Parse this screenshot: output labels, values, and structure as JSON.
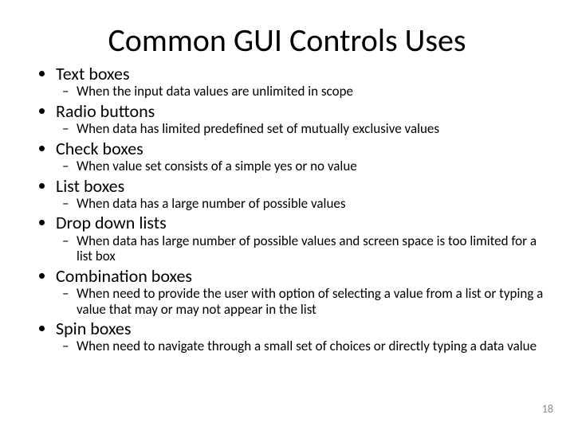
{
  "title": "Common GUI Controls Uses",
  "items": [
    {
      "label": "Text boxes",
      "desc": "When the input data values are unlimited in scope"
    },
    {
      "label": "Radio buttons",
      "desc": "When data has limited predefined set of mutually exclusive values"
    },
    {
      "label": "Check boxes",
      "desc": "When value set consists of a simple yes or no value"
    },
    {
      "label": "List boxes",
      "desc": "When data has a large number of possible values"
    },
    {
      "label": "Drop down lists",
      "desc": "When data has large number of possible values and screen space is too limited for a list box"
    },
    {
      "label": "Combination boxes",
      "desc": "When need to provide the user with option of selecting a value from a list or typing a value that may or may not appear in the list"
    },
    {
      "label": "Spin boxes",
      "desc": "When need to navigate through a small set of choices or directly typing a data value"
    }
  ],
  "page_number": "18"
}
